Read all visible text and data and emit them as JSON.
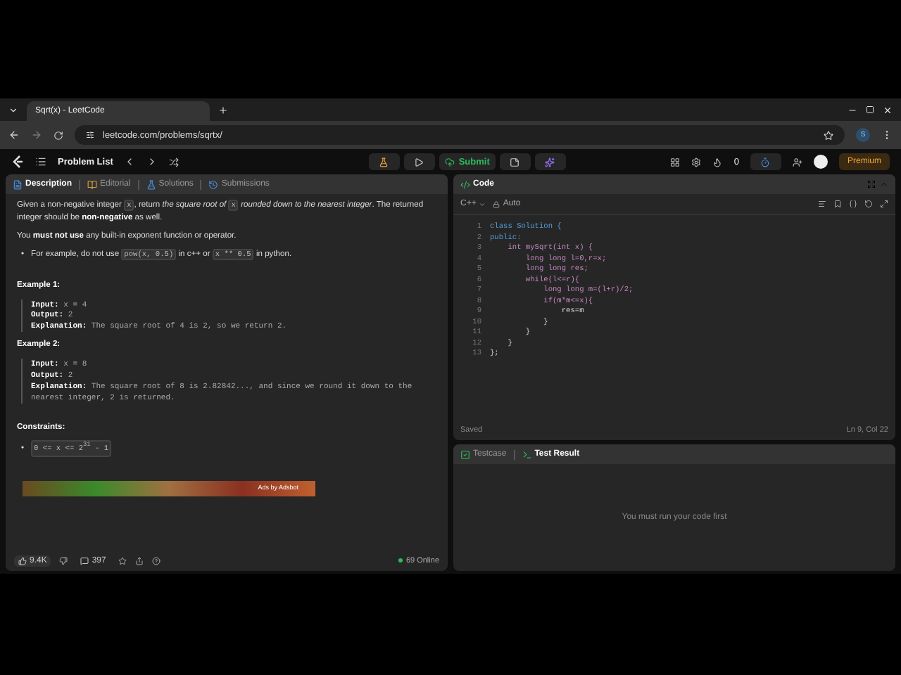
{
  "browser": {
    "tab_title": "Sqrt(x) - LeetCode",
    "url": "leetcode.com/problems/sqrtx/",
    "profile_initial": "S"
  },
  "nav": {
    "problem_list": "Problem List",
    "submit": "Submit",
    "streak_count": "0",
    "premium": "Premium"
  },
  "description_tabs": [
    {
      "label": "Description",
      "selected": true
    },
    {
      "label": "Editorial",
      "selected": false
    },
    {
      "label": "Solutions",
      "selected": false
    },
    {
      "label": "Submissions",
      "selected": false
    }
  ],
  "description": {
    "paragraphs": [
      {
        "kind": "para",
        "segments": [
          {
            "kind": "text",
            "text": "Given a non-negative integer "
          },
          {
            "kind": "code",
            "text": "x"
          },
          {
            "kind": "text",
            "text": ", return "
          },
          {
            "kind": "italic",
            "text": "the square root of "
          },
          {
            "kind": "code",
            "text": "x"
          },
          {
            "kind": "italic",
            "text": " rounded down to the nearest integer"
          },
          {
            "kind": "text",
            "text": ". The returned integer should be "
          },
          {
            "kind": "bold",
            "text": "non-negative"
          },
          {
            "kind": "text",
            "text": " as well."
          }
        ]
      },
      {
        "kind": "para",
        "segments": [
          {
            "kind": "text",
            "text": "You "
          },
          {
            "kind": "bold",
            "text": "must not use"
          },
          {
            "kind": "text",
            "text": " any built-in exponent function or operator."
          }
        ]
      },
      {
        "kind": "bullet",
        "marker": "•",
        "segments": [
          {
            "kind": "text",
            "text": "For example, do not use "
          },
          {
            "kind": "code",
            "text": "pow(x, 0.5)"
          },
          {
            "kind": "text",
            "text": " in c++ or "
          },
          {
            "kind": "code",
            "text": "x ** 0.5"
          },
          {
            "kind": "text",
            "text": " in python."
          }
        ]
      }
    ],
    "examples": [
      {
        "title": "Example 1:",
        "lines": [
          {
            "label": "Input:",
            "value": "x = 4"
          },
          {
            "label": "Output:",
            "value": "2"
          },
          {
            "label": "Explanation:",
            "value": "The square root of 4 is 2, so we return 2."
          }
        ]
      },
      {
        "title": "Example 2:",
        "lines": [
          {
            "label": "Input:",
            "value": "x = 8"
          },
          {
            "label": "Output:",
            "value": "2"
          },
          {
            "label": "Explanation:",
            "value": "The square root of 8 is 2.82842..., and since we round it down to the nearest integer, 2 is returned."
          }
        ]
      }
    ],
    "constraints_title": "Constraints:",
    "constraints": [
      {
        "marker": "•",
        "text": "0 <= x <= 2$^{31}$ - 1"
      }
    ],
    "ad_label": "Ads by Adsbot"
  },
  "footer": {
    "likes": "9.4K",
    "comments": "397",
    "online": "69 Online"
  },
  "editor": {
    "title": "Code",
    "language": "C++",
    "mode": "Auto",
    "status": "Saved",
    "cursor": "Ln 9, Col 22",
    "lines": [
      {
        "number": "1",
        "text": "class Solution {"
      },
      {
        "number": "2",
        "text": "public:"
      },
      {
        "number": "3",
        "text": "    int mySqrt(int x) {"
      },
      {
        "number": "4",
        "text": "        long long l=0,r=x;"
      },
      {
        "number": "5",
        "text": "        long long res;"
      },
      {
        "number": "6",
        "text": "        while(l<=r){"
      },
      {
        "number": "7",
        "text": "            long long m=(l+r)/2;"
      },
      {
        "number": "8",
        "text": "            if(m*m<=x){"
      },
      {
        "number": "9",
        "text": "                res=m"
      },
      {
        "number": "10",
        "text": "            }"
      },
      {
        "number": "11",
        "text": "        }"
      },
      {
        "number": "12",
        "text": "    }"
      },
      {
        "number": "13",
        "text": "};"
      }
    ]
  },
  "result_tabs": [
    {
      "label": "Testcase",
      "selected": false
    },
    {
      "label": "Test Result",
      "selected": true
    }
  ],
  "result_message": "You must run your code first"
}
